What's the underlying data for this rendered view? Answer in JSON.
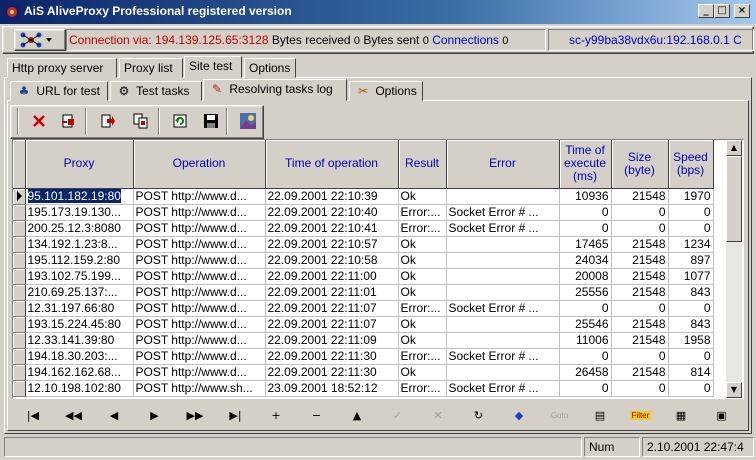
{
  "window": {
    "title": "AiS AliveProxy Professional registered version",
    "buttons": {
      "minimize": "_",
      "maximize": "□",
      "close": "×"
    }
  },
  "connection_bar": {
    "connection_via_label": "Connection via: 194.139.125.65:3128",
    "bytes_received_label": "Bytes received",
    "bytes_received_value": "0",
    "bytes_sent_label": "Bytes sent",
    "bytes_sent_value": "0",
    "connections_label": "Connections",
    "connections_value": "0",
    "host_label": "sc-y99ba38vdx6u:192.168.0.1 C"
  },
  "main_tabs": [
    {
      "label": "Http proxy server",
      "active": false
    },
    {
      "label": "Proxy list",
      "active": false
    },
    {
      "label": "Site test",
      "active": true
    },
    {
      "label": "Options",
      "active": false
    }
  ],
  "sub_tabs": [
    {
      "label": "URL for test",
      "icon": "users-icon",
      "active": false
    },
    {
      "label": "Test tasks",
      "icon": "tasks-icon",
      "active": false
    },
    {
      "label": "Resolving tasks log",
      "icon": "log-icon",
      "active": true
    },
    {
      "label": "Options",
      "icon": "tools-icon",
      "active": false
    }
  ],
  "toolbar": [
    {
      "icon": "delete-icon"
    },
    {
      "icon": "clear-log-icon"
    },
    {
      "icon": "export-icon"
    },
    {
      "icon": "copy-icon"
    },
    {
      "icon": "refresh-icon"
    },
    {
      "icon": "save-icon"
    },
    {
      "icon": "picture-icon"
    }
  ],
  "grid": {
    "columns": [
      "Proxy",
      "Operation",
      "Time of operation",
      "Result",
      "Error",
      "Time of execute (ms)",
      "Size (byte)",
      "Speed (bps)"
    ],
    "rows": [
      [
        "95.101.182.19:80",
        "POST http://www.d...",
        "22.09.2001 22:10:39",
        "Ok",
        "",
        "10936",
        "21548",
        "1970"
      ],
      [
        "195.173.19.130...",
        "POST http://www.d...",
        "22.09.2001 22:10:40",
        "Error:...",
        "Socket Error # ...",
        "0",
        "0",
        "0"
      ],
      [
        "200.25.12.3:8080",
        "POST http://www.d...",
        "22.09.2001 22:10:41",
        "Error:...",
        "Socket Error # ...",
        "0",
        "0",
        "0"
      ],
      [
        "134.192.1.23:8...",
        "POST http://www.d...",
        "22.09.2001 22:10:57",
        "Ok",
        "",
        "17465",
        "21548",
        "1234"
      ],
      [
        "195.112.159.2:80",
        "POST http://www.d...",
        "22.09.2001 22:10:58",
        "Ok",
        "",
        "24034",
        "21548",
        "897"
      ],
      [
        "193.102.75.199...",
        "POST http://www.d...",
        "22.09.2001 22:11:00",
        "Ok",
        "",
        "20008",
        "21548",
        "1077"
      ],
      [
        "210.69.25.137:...",
        "POST http://www.d...",
        "22.09.2001 22:11:01",
        "Ok",
        "",
        "25556",
        "21548",
        "843"
      ],
      [
        "12.31.197.66:80",
        "POST http://www.d...",
        "22.09.2001 22:11:07",
        "Error:...",
        "Socket Error # ...",
        "0",
        "0",
        "0"
      ],
      [
        "193.15.224.45:80",
        "POST http://www.d...",
        "22.09.2001 22:11:07",
        "Ok",
        "",
        "25546",
        "21548",
        "843"
      ],
      [
        "12.33.141.39:80",
        "POST http://www.d...",
        "22.09.2001 22:11:09",
        "Ok",
        "",
        "11006",
        "21548",
        "1958"
      ],
      [
        "194.18.30.203:...",
        "POST http://www.d...",
        "22.09.2001 22:11:30",
        "Error:...",
        "Socket Error # ...",
        "0",
        "0",
        "0"
      ],
      [
        "194.162.162.68...",
        "POST http://www.d...",
        "22.09.2001 22:11:30",
        "Ok",
        "",
        "26458",
        "21548",
        "814"
      ],
      [
        "12.10.198.102:80",
        "POST http://www.sh...",
        "23.09.2001 18:52:12",
        "Error:...",
        "Socket Error # ...",
        "0",
        "0",
        "0"
      ]
    ],
    "selected_row": 0
  },
  "navigator": [
    {
      "name": "first-record-button",
      "glyph": "|◀"
    },
    {
      "name": "prior-page-button",
      "glyph": "◀◀"
    },
    {
      "name": "prior-record-button",
      "glyph": "◀"
    },
    {
      "name": "next-record-button",
      "glyph": "▶"
    },
    {
      "name": "next-page-button",
      "glyph": "▶▶"
    },
    {
      "name": "last-record-button",
      "glyph": "▶|"
    },
    {
      "name": "insert-record-button",
      "glyph": "+"
    },
    {
      "name": "delete-record-button",
      "glyph": "−"
    },
    {
      "name": "edit-record-button",
      "glyph": "▲"
    },
    {
      "name": "post-record-button",
      "glyph": "✓"
    },
    {
      "name": "cancel-record-button",
      "glyph": "✕"
    },
    {
      "name": "refresh-record-button",
      "glyph": "↻"
    },
    {
      "name": "bookmark-button",
      "glyph": "◆"
    },
    {
      "name": "goto-bookmark-button",
      "glyph": "Goto"
    },
    {
      "name": "print-button",
      "glyph": "▤"
    },
    {
      "name": "filter-button",
      "glyph": "Filter"
    },
    {
      "name": "report-button",
      "glyph": "▦"
    },
    {
      "name": "print-preview-button",
      "glyph": "▣"
    }
  ],
  "status_bar": {
    "panel1": "",
    "num": "Num",
    "datetime": "2.10.2001 22:47:4"
  },
  "colors": {
    "title_gradient_start": "#0a246a",
    "connection_red": "#c00000",
    "connections_blue": "#0000c0",
    "header_text_blue": "#0000c0",
    "selection_blue": "#0a246a"
  }
}
